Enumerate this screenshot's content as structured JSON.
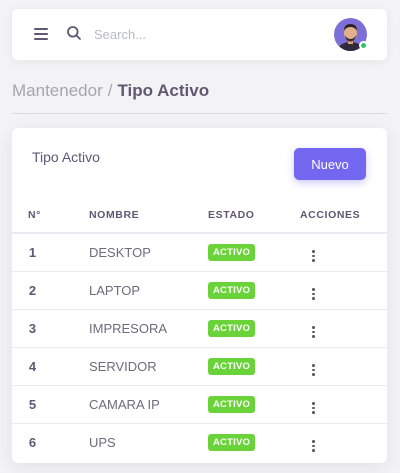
{
  "header": {
    "search_placeholder": "Search...",
    "icons": {
      "menu": "menu-icon",
      "search": "search-icon",
      "avatar": "user-avatar"
    },
    "status_color": "#28c76f"
  },
  "breadcrumb": {
    "parent": "Mantenedor",
    "separator": "/",
    "current": "Tipo Activo"
  },
  "card": {
    "title": "Tipo Activo",
    "new_button": "Nuevo",
    "accent_color": "#7367f0"
  },
  "table": {
    "headers": [
      "N°",
      "NOMBRE",
      "ESTADO",
      "ACCIONES"
    ],
    "rows": [
      {
        "num": "1",
        "nombre": "DESKTOP",
        "estado": "ACTIVO"
      },
      {
        "num": "2",
        "nombre": "LAPTOP",
        "estado": "ACTIVO"
      },
      {
        "num": "3",
        "nombre": "IMPRESORA",
        "estado": "ACTIVO"
      },
      {
        "num": "4",
        "nombre": "SERVIDOR",
        "estado": "ACTIVO"
      },
      {
        "num": "5",
        "nombre": "CAMARA IP",
        "estado": "ACTIVO"
      },
      {
        "num": "6",
        "nombre": "UPS",
        "estado": "ACTIVO"
      }
    ],
    "badge_color": "#6bd33a",
    "action_icon": "more-vertical-icon"
  }
}
